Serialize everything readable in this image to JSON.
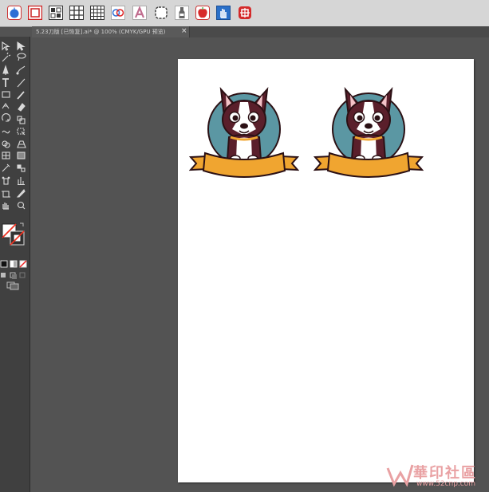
{
  "app": {
    "document_tab": {
      "title": "5.23刀版 [已恢复].ai* @ 100% (CMYK/GPU 预览)",
      "close_glyph": "×"
    }
  },
  "top_toolbar": {
    "icons": [
      "apple-blue-icon",
      "red-square-frame-icon",
      "grid-pattern-icon",
      "grid-3x3-icon",
      "grid-4x4-icon",
      "overlap-circles-icon",
      "letter-a-icon",
      "rounded-square-outline-icon",
      "bottle-icon",
      "apple-red-icon",
      "hand-tool-icon",
      "red-badge-icon"
    ]
  },
  "left_toolbar": {
    "tools": [
      "selection-tool-icon",
      "direct-selection-tool-icon",
      "magic-wand-tool-icon",
      "lasso-tool-icon",
      "pen-tool-icon",
      "curvature-tool-icon",
      "type-tool-icon",
      "line-tool-icon",
      "rectangle-tool-icon",
      "paintbrush-tool-icon",
      "shaper-tool-icon",
      "eraser-tool-icon",
      "rotate-tool-icon",
      "scale-tool-icon",
      "width-tool-icon",
      "free-transform-tool-icon",
      "shape-builder-tool-icon",
      "perspective-grid-tool-icon",
      "mesh-tool-icon",
      "gradient-tool-icon",
      "eyedropper-tool-icon",
      "blend-tool-icon",
      "symbol-sprayer-tool-icon",
      "column-graph-tool-icon",
      "artboard-tool-icon",
      "slice-tool-icon",
      "hand-tool-icon",
      "zoom-tool-icon"
    ],
    "fill_stroke": "fill-stroke-swatch-icon",
    "color_modes": [
      "color-mode-icon",
      "gradient-mode-icon",
      "none-mode-icon"
    ],
    "draw_modes": [
      "draw-normal-icon",
      "draw-behind-icon",
      "draw-inside-icon"
    ],
    "screen_mode": "screen-mode-icon"
  },
  "artboard": {
    "badges": [
      {
        "name": "boston-terrier-badge-left"
      },
      {
        "name": "boston-terrier-badge-right"
      }
    ],
    "colors": {
      "circle": "#5b97a3",
      "banner": "#f0a530",
      "fur_dark": "#5a1f2b",
      "outline": "#2b1014"
    }
  },
  "watermark": {
    "title": "華印社區",
    "url": "www.52cnp.com"
  }
}
